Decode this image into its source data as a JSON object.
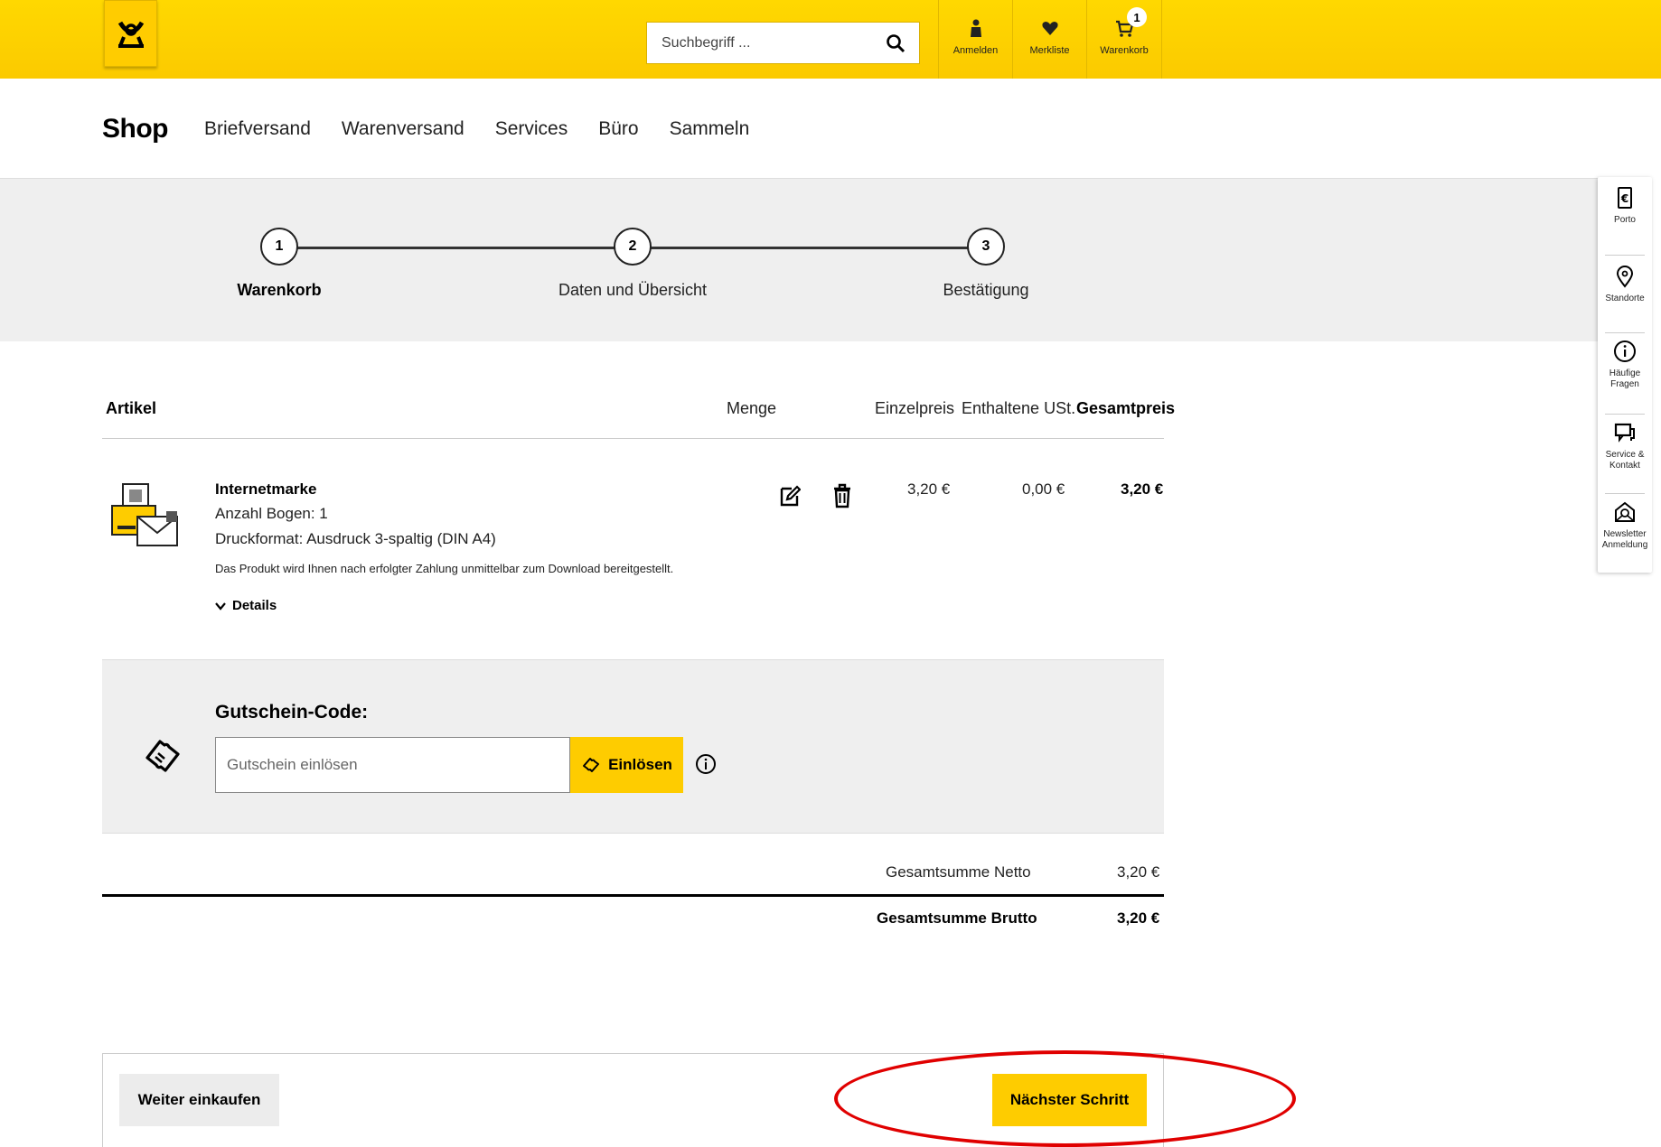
{
  "header": {
    "search_placeholder": "Suchbegriff ...",
    "login_label": "Anmelden",
    "wishlist_label": "Merkliste",
    "cart_label": "Warenkorb",
    "cart_count": "1"
  },
  "nav": {
    "shop": "Shop",
    "items": [
      "Briefversand",
      "Warenversand",
      "Services",
      "Büro",
      "Sammeln"
    ]
  },
  "stepper": {
    "steps": [
      {
        "num": "1",
        "label": "Warenkorb"
      },
      {
        "num": "2",
        "label": "Daten und Übersicht"
      },
      {
        "num": "3",
        "label": "Bestätigung"
      }
    ]
  },
  "sidebar": {
    "porto": "Porto",
    "standorte": "Standorte",
    "faq_line1": "Häufige",
    "faq_line2": "Fragen",
    "service_line1": "Service &",
    "service_line2": "Kontakt",
    "newsletter_line1": "Newsletter",
    "newsletter_line2": "Anmeldung"
  },
  "table": {
    "col_article": "Artikel",
    "col_qty": "Menge",
    "col_unit_price": "Einzelpreis",
    "col_vat": "Enthaltene USt.",
    "col_total": "Gesamtpreis"
  },
  "product": {
    "name": "Internetmarke",
    "sheets": "Anzahl Bogen: 1",
    "format": "Druckformat: Ausdruck 3-spaltig (DIN A4)",
    "note": "Das Produkt wird Ihnen nach erfolgter Zahlung unmittelbar zum Download bereitgestellt.",
    "details": "Details",
    "unit_price": "3,20 €",
    "vat": "0,00 €",
    "total": "3,20 €"
  },
  "voucher": {
    "title": "Gutschein-Code:",
    "placeholder": "Gutschein einlösen",
    "button": "Einlösen"
  },
  "totals": {
    "net_label": "Gesamtsumme Netto",
    "net_value": "3,20 €",
    "gross_label": "Gesamtsumme Brutto",
    "gross_value": "3,20 €"
  },
  "footer": {
    "continue": "Weiter einkaufen",
    "next": "Nächster Schritt"
  },
  "colors": {
    "brand_yellow": "#fecc00",
    "annotation_red": "#e00000"
  }
}
